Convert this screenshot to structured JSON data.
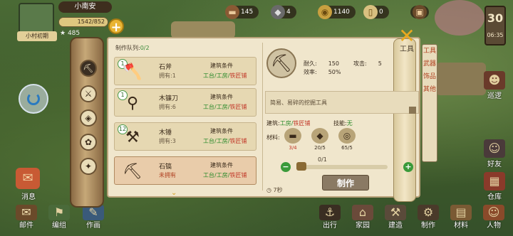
{
  "village": {
    "name": "小南安",
    "progress": "1542/852",
    "progress_fraction": 1.0,
    "label": "小村初期",
    "population": "485"
  },
  "resources": [
    {
      "icon": "wood-icon",
      "value": "145"
    },
    {
      "icon": "ore-icon",
      "value": "4"
    },
    {
      "icon": "coin-icon",
      "value": "1140"
    },
    {
      "icon": "scroll-icon",
      "value": "0"
    }
  ],
  "day": {
    "number": "30",
    "time": "06:35"
  },
  "left_buttons": [
    {
      "label": "消息",
      "icon": "message-icon"
    }
  ],
  "bottom_left": [
    {
      "label": "邮件",
      "icon": "mail-icon"
    },
    {
      "label": "编组",
      "icon": "group-icon"
    },
    {
      "label": "作画",
      "icon": "paint-icon"
    }
  ],
  "bottom_right": [
    {
      "label": "出行",
      "icon": "travel-icon"
    },
    {
      "label": "家园",
      "icon": "home-icon"
    },
    {
      "label": "建造",
      "icon": "build-icon"
    },
    {
      "label": "制作",
      "icon": "craft-icon"
    },
    {
      "label": "材料",
      "icon": "material-icon"
    },
    {
      "label": "人物",
      "icon": "character-icon"
    }
  ],
  "right_side": [
    {
      "label": "巡逻",
      "icon": "patrol-icon"
    },
    {
      "label": "好友",
      "icon": "friend-icon"
    },
    {
      "label": "仓库",
      "icon": "warehouse-icon"
    }
  ],
  "craft": {
    "queue_label": "制作队列:",
    "queue_value": "0/2",
    "category_tabs": [
      "工具",
      "武器",
      "饰品",
      "其他"
    ],
    "category_title": "工具",
    "recipes": [
      {
        "level": "1",
        "name": "石斧",
        "owned": "拥有:1",
        "cond_label": "建筑条件",
        "req_ok": "工台/工房/",
        "req_bad": "铁匠铺",
        "tool": "axe-icon"
      },
      {
        "level": "1",
        "name": "木镰刀",
        "owned": "拥有:6",
        "cond_label": "建筑条件",
        "req_ok": "工台/工房/",
        "req_bad": "铁匠铺",
        "tool": "sickle-icon"
      },
      {
        "level": "12",
        "name": "木锤",
        "owned": "拥有:3",
        "cond_label": "建筑条件",
        "req_ok": "工台/工房/",
        "req_bad": "铁匠铺",
        "tool": "hammer-icon"
      },
      {
        "level": "",
        "name": "石镐",
        "owned": "未拥有",
        "cond_label": "建筑条件",
        "req_ok": "工台/工房/",
        "req_bad": "铁匠铺",
        "tool": "pickaxe-icon"
      }
    ],
    "detail": {
      "durability_label": "耐久:",
      "durability_value": "150",
      "attack_label": "攻击:",
      "attack_value": "5",
      "efficiency_label": "效率:",
      "efficiency_value": "50%",
      "description": "简易、易碎的挖掘工具",
      "building_label": "建筑:",
      "building_ok": "工房/",
      "building_bad": "铁匠铺",
      "skill_label": "技能:",
      "skill_value": "无",
      "material_label": "材料:",
      "materials": [
        {
          "icon": "log-icon",
          "count": "3/4",
          "ok": false
        },
        {
          "icon": "stone-icon",
          "count": "20/5",
          "ok": true
        },
        {
          "icon": "rope-icon",
          "count": "65/5",
          "ok": true
        }
      ],
      "quantity": "0/1",
      "time": "7秒",
      "make_label": "制作"
    }
  }
}
